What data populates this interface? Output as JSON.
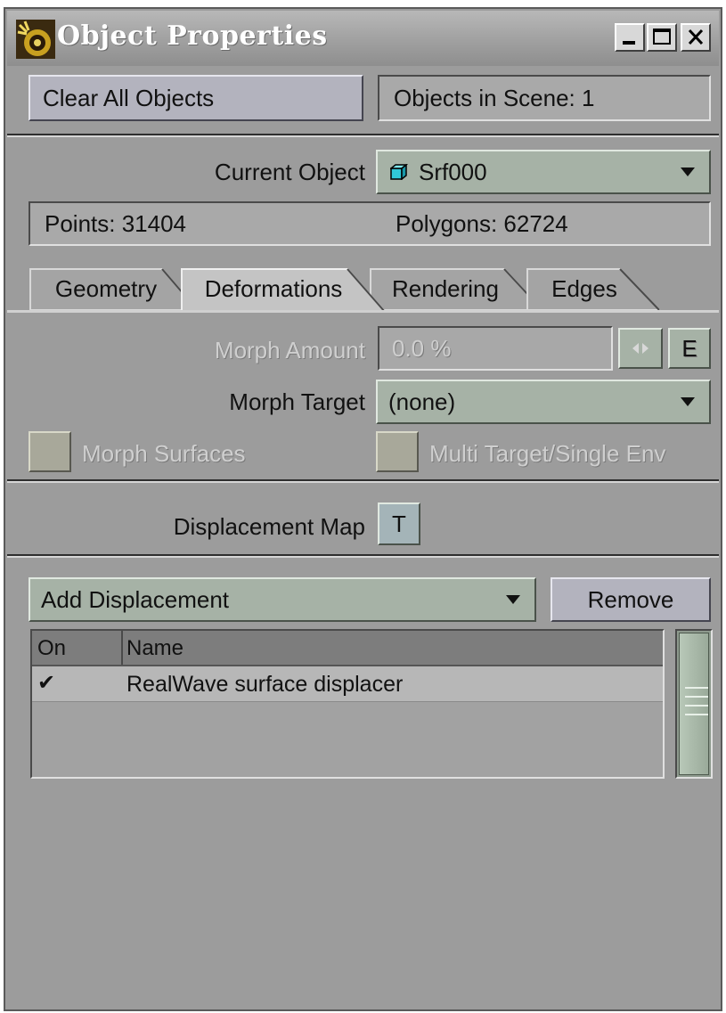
{
  "window": {
    "title": "Object Properties",
    "icon": "lightwave-app-icon",
    "controls": [
      "minimize-icon",
      "maximize-icon",
      "close-icon"
    ]
  },
  "top": {
    "clear_all_label": "Clear All Objects",
    "objects_in_scene": "Objects in Scene: 1"
  },
  "object": {
    "current_label": "Current Object",
    "current_value": "Srf000",
    "current_icon": "cube-icon",
    "points": "Points: 31404",
    "polygons": "Polygons: 62724"
  },
  "tabs": [
    {
      "label": "Geometry",
      "active": false
    },
    {
      "label": "Deformations",
      "active": true
    },
    {
      "label": "Rendering",
      "active": false
    },
    {
      "label": "Edges",
      "active": false
    }
  ],
  "deformations": {
    "morph_amount_label": "Morph Amount",
    "morph_amount_value": "0.0 %",
    "envelope_button": "E",
    "morph_target_label": "Morph Target",
    "morph_target_value": "(none)",
    "morph_surfaces_label": "Morph Surfaces",
    "multi_target_label": "Multi Target/Single Env",
    "displacement_map_label": "Displacement Map",
    "texture_button": "T"
  },
  "displacement": {
    "add_label": "Add Displacement",
    "remove_label": "Remove",
    "columns": [
      "On",
      "Name"
    ],
    "rows": [
      {
        "on": "✔",
        "name": "RealWave surface displacer"
      }
    ]
  },
  "colors": {
    "panel_bg": "#9c9c9c",
    "button_bg": "#b3b3be",
    "dropdown_bg": "#a6b2a6",
    "disabled_text": "#cfcfcf"
  }
}
